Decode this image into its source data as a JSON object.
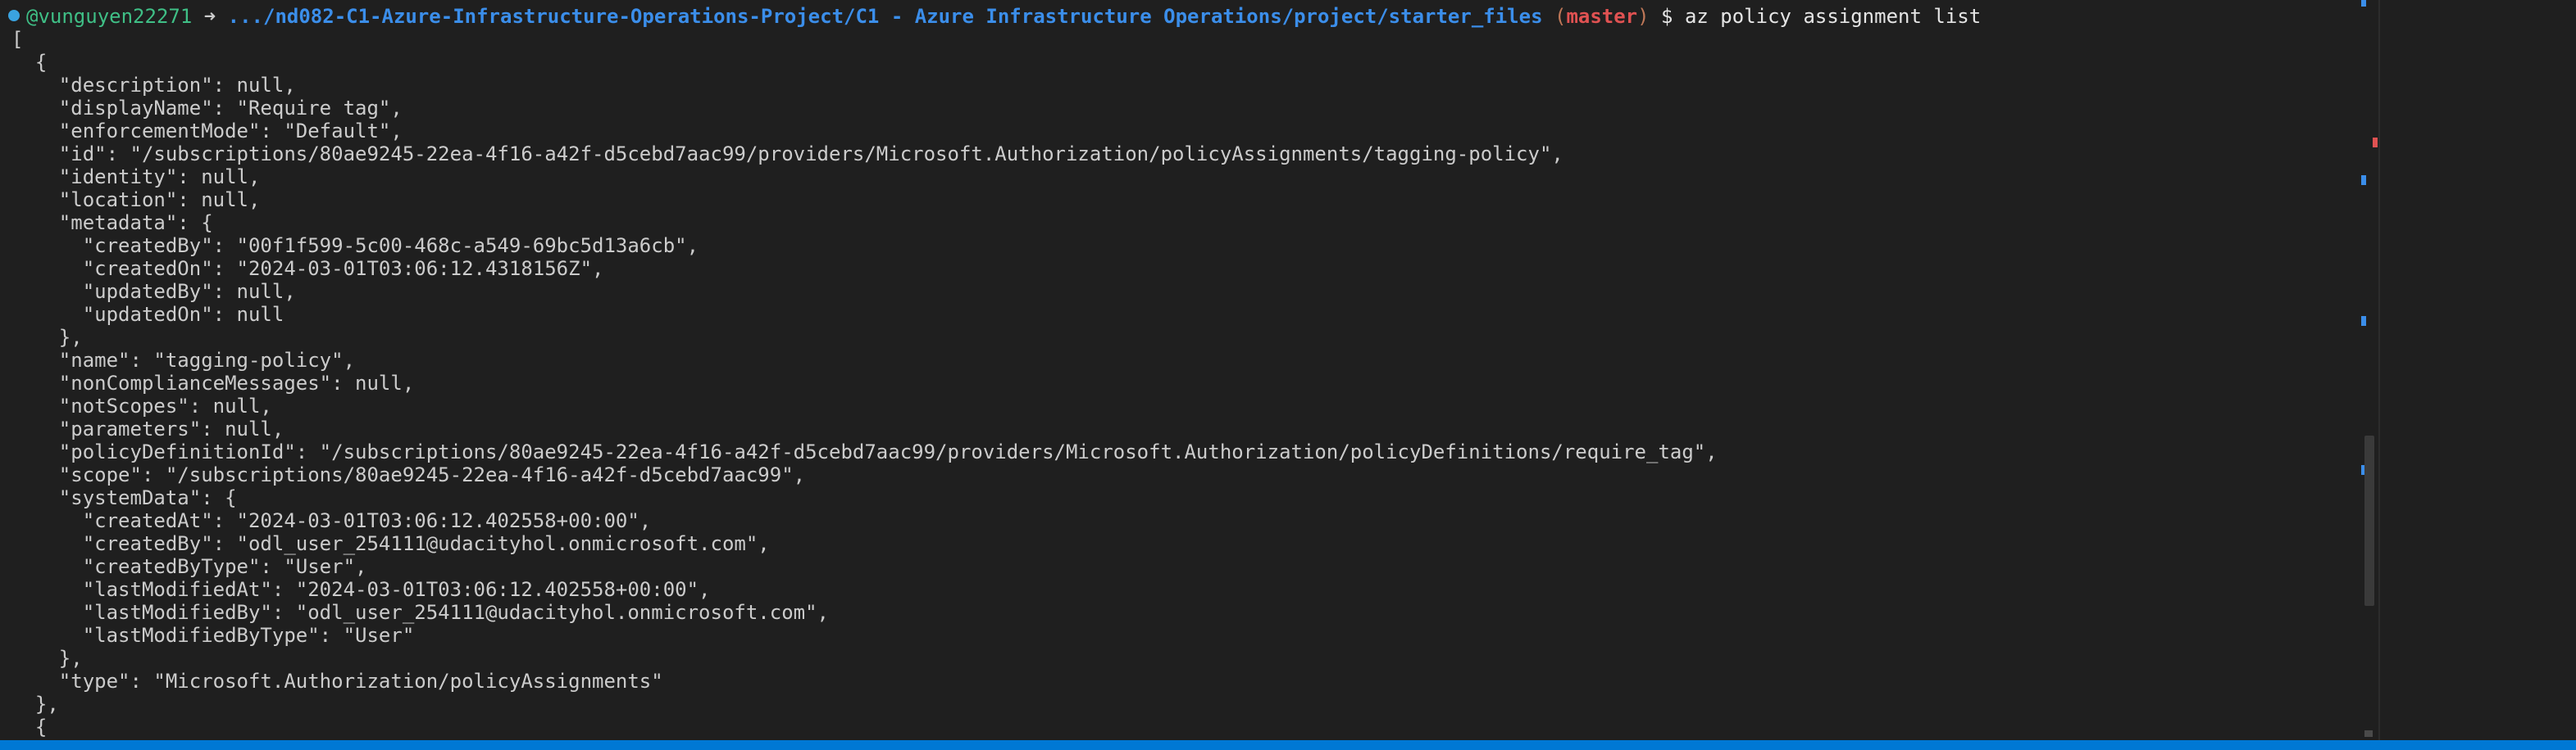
{
  "prompt": {
    "user": "@vunguyen22271",
    "arrow": "➜",
    "path": ".../nd082-C1-Azure-Infrastructure-Operations-Project/C1 - Azure Infrastructure Operations/project/starter_files",
    "paren_open": "(",
    "branch": "master",
    "paren_close": ")",
    "command": "$ az policy assignment list"
  },
  "output_lines": [
    "[",
    "  {",
    "    \"description\": null,",
    "    \"displayName\": \"Require tag\",",
    "    \"enforcementMode\": \"Default\",",
    "    \"id\": \"/subscriptions/80ae9245-22ea-4f16-a42f-d5cebd7aac99/providers/Microsoft.Authorization/policyAssignments/tagging-policy\",",
    "    \"identity\": null,",
    "    \"location\": null,",
    "    \"metadata\": {",
    "      \"createdBy\": \"00f1f599-5c00-468c-a549-69bc5d13a6cb\",",
    "      \"createdOn\": \"2024-03-01T03:06:12.4318156Z\",",
    "      \"updatedBy\": null,",
    "      \"updatedOn\": null",
    "    },",
    "    \"name\": \"tagging-policy\",",
    "    \"nonComplianceMessages\": null,",
    "    \"notScopes\": null,",
    "    \"parameters\": null,",
    "    \"policyDefinitionId\": \"/subscriptions/80ae9245-22ea-4f16-a42f-d5cebd7aac99/providers/Microsoft.Authorization/policyDefinitions/require_tag\",",
    "    \"scope\": \"/subscriptions/80ae9245-22ea-4f16-a42f-d5cebd7aac99\",",
    "    \"systemData\": {",
    "      \"createdAt\": \"2024-03-01T03:06:12.402558+00:00\",",
    "      \"createdBy\": \"odl_user_254111@udacityhol.onmicrosoft.com\",",
    "      \"createdByType\": \"User\",",
    "      \"lastModifiedAt\": \"2024-03-01T03:06:12.402558+00:00\",",
    "      \"lastModifiedBy\": \"odl_user_254111@udacityhol.onmicrosoft.com\",",
    "      \"lastModifiedByType\": \"User\"",
    "    },",
    "    \"type\": \"Microsoft.Authorization/policyAssignments\"",
    "  },",
    "  {"
  ],
  "colors": {
    "background": "#1f1f1f",
    "text": "#cccccc",
    "user": "#3fbf86",
    "path": "#3b8eea",
    "branch": "#e05252",
    "status_bar": "#0078d4"
  }
}
